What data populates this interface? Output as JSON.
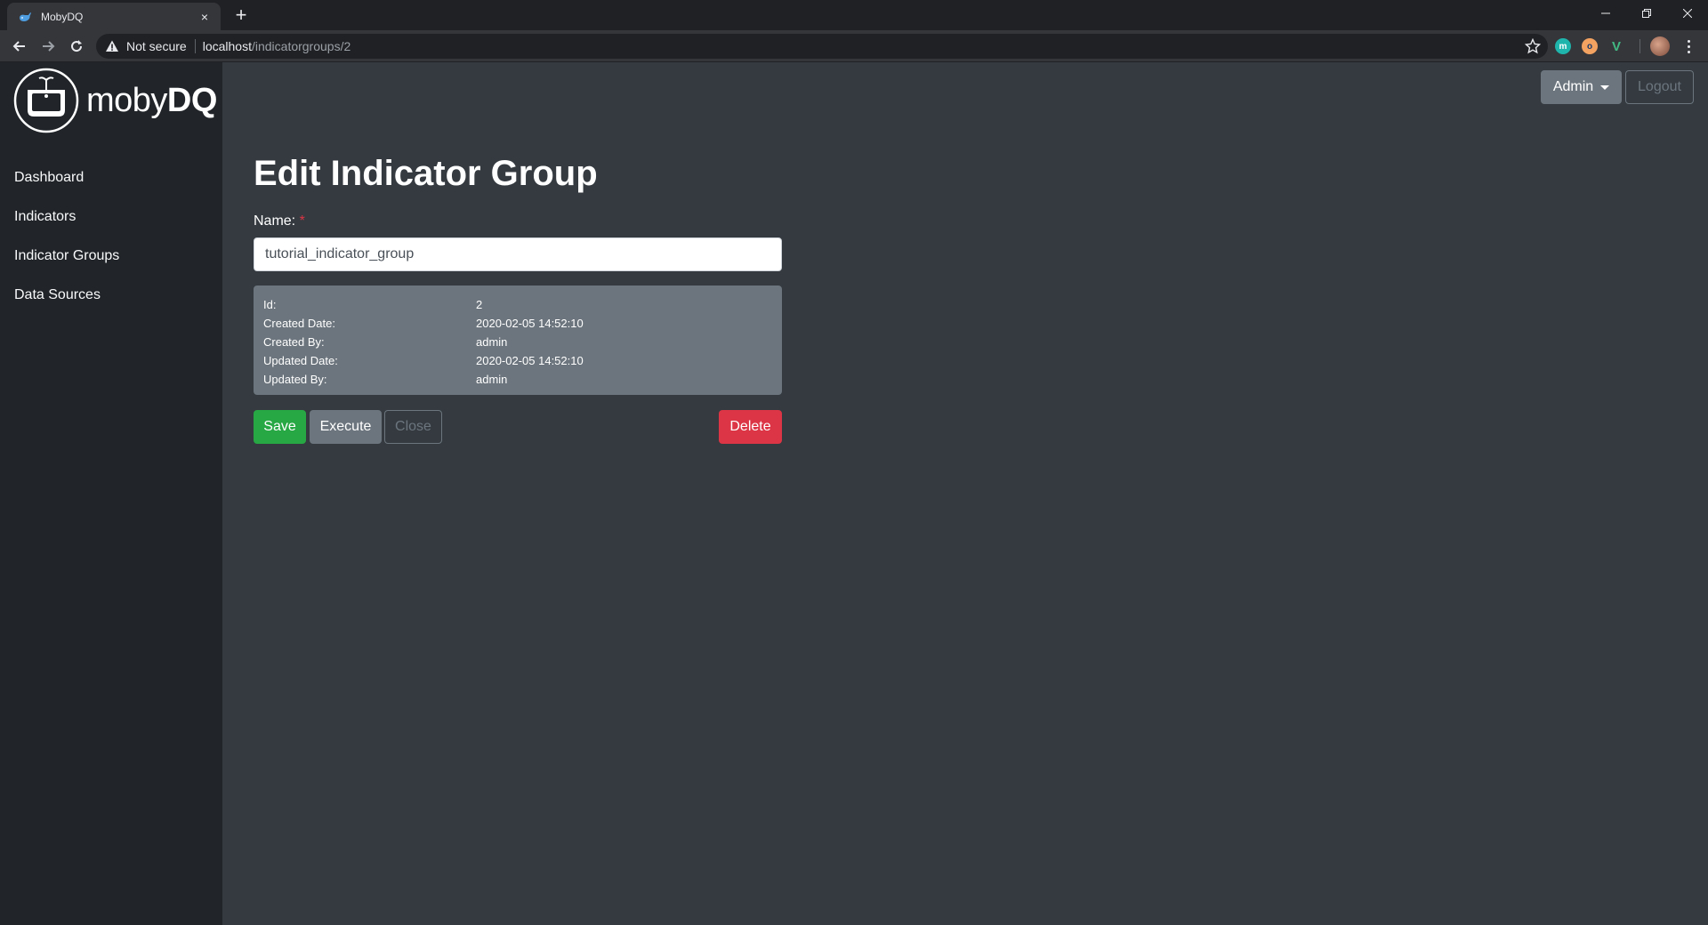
{
  "browser": {
    "tab_title": "MobyDQ",
    "tab_close": "×",
    "new_tab": "+",
    "security_label": "Not secure",
    "url_host": "localhost",
    "url_path": "/indicatorgroups/2",
    "extensions": [
      {
        "name": "m",
        "color": "#1fb5ad"
      },
      {
        "name": "o",
        "color": "#f4a261"
      },
      {
        "name": "V",
        "color": "#42b883"
      }
    ]
  },
  "app": {
    "logo_text_a": "moby",
    "logo_text_b": "DQ",
    "nav": [
      {
        "label": "Dashboard"
      },
      {
        "label": "Indicators"
      },
      {
        "label": "Indicator Groups"
      },
      {
        "label": "Data Sources"
      }
    ],
    "user": {
      "admin_label": "Admin",
      "logout_label": "Logout"
    }
  },
  "page": {
    "title": "Edit Indicator Group",
    "name_label": "Name:",
    "required_marker": "*",
    "name_value": "tutorial_indicator_group",
    "meta": [
      {
        "key": "Id:",
        "value": "2"
      },
      {
        "key": "Created Date:",
        "value": "2020-02-05 14:52:10"
      },
      {
        "key": "Created By:",
        "value": "admin"
      },
      {
        "key": "Updated Date:",
        "value": "2020-02-05 14:52:10"
      },
      {
        "key": "Updated By:",
        "value": "admin"
      }
    ],
    "buttons": {
      "save": "Save",
      "execute": "Execute",
      "close": "Close",
      "delete": "Delete"
    }
  },
  "colors": {
    "sidebar_bg": "#212529",
    "main_bg": "#343a40",
    "secondary": "#6c757d",
    "success": "#28a745",
    "danger": "#dc3545"
  }
}
